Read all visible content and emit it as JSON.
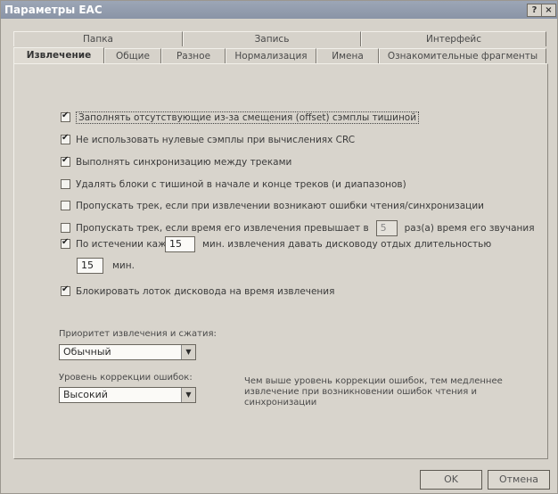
{
  "window": {
    "title": "Параметры EAC",
    "help_btn": "?",
    "close_btn": "×"
  },
  "tabs_back": [
    "Папка",
    "Запись",
    "Интерфейс"
  ],
  "tabs_front": [
    "Извлечение",
    "Общие",
    "Разное",
    "Нормализация",
    "Имена",
    "Ознакомительные фрагменты"
  ],
  "options": [
    {
      "label": "Заполнять отсутствующие из-за смещения (offset) сэмплы тишиной",
      "checked": true
    },
    {
      "label": "Не использовать нулевые сэмплы при вычислениях CRC",
      "checked": true
    },
    {
      "label": "Выполнять синхронизацию между треками",
      "checked": true
    },
    {
      "label": "Удалять блоки с тишиной в начале и конце треков (и диапазонов)",
      "checked": false
    },
    {
      "label": "Пропускать трек, если при извлечении возникают ошибки чтения/синхронизации",
      "checked": false
    }
  ],
  "skip_time": {
    "label_before": "Пропускать трек, если время его извлечения превышает в",
    "value": "5",
    "label_after": "раз(а) время его звучания",
    "checked": false
  },
  "rest": {
    "label_before": "По истечении каждых",
    "minutes": "15",
    "label_after": "мин. извлечения давать дисководу отдых длительностью",
    "rest_value": "15",
    "rest_unit": "мин.",
    "checked": true
  },
  "lock_tray": {
    "label": "Блокировать лоток дисковода на время извлечения",
    "checked": true
  },
  "priority": {
    "label": "Приоритет извлечения и сжатия:",
    "value": "Обычный"
  },
  "correction": {
    "label": "Уровень коррекции ошибок:",
    "value": "Высокий",
    "hint": "Чем выше уровень коррекции ошибок, тем медленнее извлечение при возникновении ошибок чтения и синхронизации"
  },
  "buttons": {
    "ok": "OK",
    "cancel": "Отмена"
  }
}
